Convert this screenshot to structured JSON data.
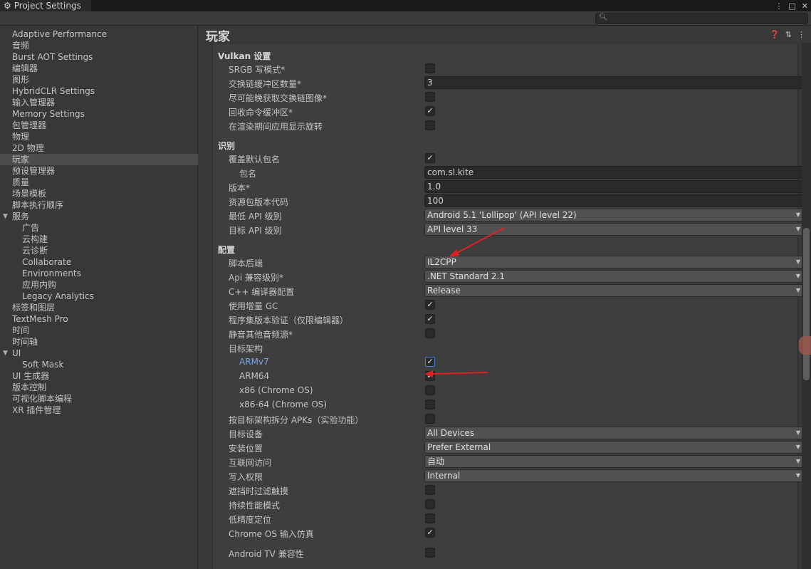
{
  "window": {
    "title": "Project Settings",
    "gear_icon": "gear-icon",
    "controls": [
      "⋮",
      "□",
      "✕"
    ]
  },
  "search": {
    "value": "",
    "icon": "search-icon"
  },
  "sidebar": {
    "items": [
      {
        "label": "Adaptive Performance"
      },
      {
        "label": "音频"
      },
      {
        "label": "Burst AOT Settings"
      },
      {
        "label": "编辑器"
      },
      {
        "label": "图形"
      },
      {
        "label": "HybridCLR Settings"
      },
      {
        "label": "输入管理器"
      },
      {
        "label": "Memory Settings"
      },
      {
        "label": "包管理器"
      },
      {
        "label": "物理"
      },
      {
        "label": "2D 物理"
      },
      {
        "label": "玩家"
      },
      {
        "label": "预设管理器"
      },
      {
        "label": "质量"
      },
      {
        "label": "场景模板"
      },
      {
        "label": "脚本执行顺序"
      },
      {
        "label": "服务"
      },
      {
        "label": "广告"
      },
      {
        "label": "云构建"
      },
      {
        "label": "云诊断"
      },
      {
        "label": "Collaborate"
      },
      {
        "label": "Environments"
      },
      {
        "label": "应用内购"
      },
      {
        "label": "Legacy Analytics"
      },
      {
        "label": "标签和图层"
      },
      {
        "label": "TextMesh Pro"
      },
      {
        "label": "时间"
      },
      {
        "label": "时间轴"
      },
      {
        "label": "UI"
      },
      {
        "label": "Soft Mask"
      },
      {
        "label": "UI 生成器"
      },
      {
        "label": "版本控制"
      },
      {
        "label": "可视化脚本编程"
      },
      {
        "label": "XR 插件管理"
      }
    ]
  },
  "main": {
    "title": "玩家",
    "header_icons": [
      "help-icon",
      "preset-icon",
      "more-icon"
    ],
    "sections": {
      "vulkan": "Vulkan 设置",
      "identity": "识别",
      "config": "配置"
    },
    "rows": {
      "srgb": {
        "label": "SRGB 写模式*",
        "checked": false
      },
      "swapchain": {
        "label": "交换链缓冲区数量*",
        "value": "3"
      },
      "late_acquire": {
        "label": "尽可能晚获取交换链图像*",
        "checked": false
      },
      "recycle_cmd": {
        "label": "回收命令缓冲区*",
        "checked": true
      },
      "prerotation": {
        "label": "在渲染期间应用显示旋转",
        "checked": false
      },
      "override_pkg": {
        "label": "覆盖默认包名",
        "checked": true
      },
      "pkg_name": {
        "label": "包名",
        "value": "com.sl.kite"
      },
      "version": {
        "label": "版本*",
        "value": "1.0"
      },
      "bundle_code": {
        "label": "资源包版本代码",
        "value": "100"
      },
      "min_api": {
        "label": "最低 API 级别",
        "value": "Android 5.1 'Lollipop' (API level 22)"
      },
      "target_api": {
        "label": "目标 API 级别",
        "value": "API level 33"
      },
      "scripting_backend": {
        "label": "脚本后端",
        "value": "IL2CPP"
      },
      "api_compat": {
        "label": "Api 兼容级别*",
        "value": ".NET Standard 2.1"
      },
      "cpp_config": {
        "label": "C++ 编译器配置",
        "value": "Release"
      },
      "incremental_gc": {
        "label": "使用增量 GC",
        "checked": true
      },
      "assembly_validation": {
        "label": "程序集版本验证（仅限编辑器）",
        "checked": true
      },
      "mute_audio": {
        "label": "静音其他音频源*",
        "checked": false
      },
      "target_arch": {
        "label": "目标架构"
      },
      "armv7": {
        "label": "ARMv7",
        "checked": true
      },
      "arm64": {
        "label": "ARM64",
        "checked": true
      },
      "x86": {
        "label": "x86 (Chrome OS)",
        "checked": false
      },
      "x86_64": {
        "label": "x86-64 (Chrome OS)",
        "checked": false
      },
      "split_apks": {
        "label": "按目标架构拆分 APKs（实验功能）",
        "checked": false
      },
      "target_devices": {
        "label": "目标设备",
        "value": "All Devices"
      },
      "install_location": {
        "label": "安装位置",
        "value": "Prefer External"
      },
      "internet_access": {
        "label": "互联网访问",
        "value": "自动"
      },
      "write_permission": {
        "label": "写入权限",
        "value": "Internal"
      },
      "filter_touches": {
        "label": "遮挡时过滤触摸",
        "checked": false
      },
      "sustained_perf": {
        "label": "持续性能模式",
        "checked": false
      },
      "low_accuracy": {
        "label": "低精度定位",
        "checked": false
      },
      "chromeos_input": {
        "label": "Chrome OS 输入仿真",
        "checked": true
      },
      "android_tv": {
        "label": "Android TV 兼容性",
        "checked": false
      }
    }
  },
  "colors": {
    "annotation_arrow": "#e02020",
    "selected_bg": "#4d4d4d",
    "link_blue": "#7ba6e6"
  }
}
